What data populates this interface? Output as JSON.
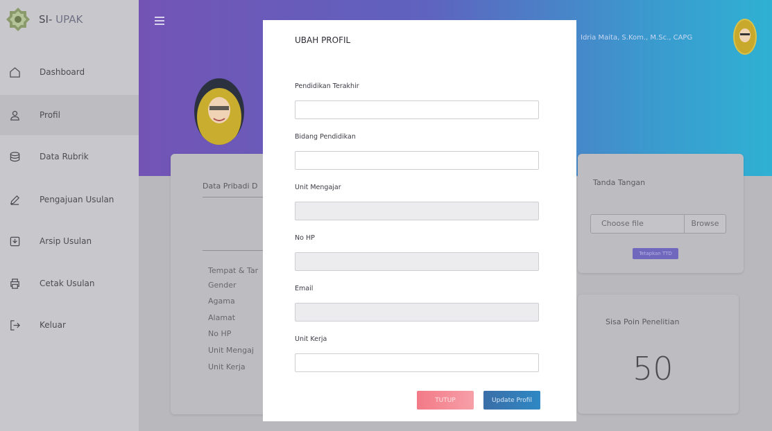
{
  "app": {
    "brand_prefix": "SI-",
    "brand_suffix": "UPAK"
  },
  "sidebar": {
    "items": [
      {
        "label": "Dashboard",
        "icon": "home-icon"
      },
      {
        "label": "Profil",
        "icon": "user-icon",
        "active": true
      },
      {
        "label": "Data Rubrik",
        "icon": "database-icon"
      },
      {
        "label": "Pengajuan Usulan",
        "icon": "pencil-icon"
      },
      {
        "label": "Arsip Usulan",
        "icon": "archive-icon"
      },
      {
        "label": "Cetak Usulan",
        "icon": "printer-icon"
      },
      {
        "label": "Keluar",
        "icon": "logout-icon"
      }
    ]
  },
  "header": {
    "user_name": "Idria Maita, S.Kom., M.Sc., CAPG"
  },
  "data_pribadi": {
    "title": "Data Pribadi D",
    "rows": [
      "Tempat & Tar",
      "Gender",
      "Agama",
      "Alamat",
      "No HP",
      "Unit Mengaj",
      "Unit Kerja"
    ]
  },
  "ttd": {
    "title": "Tanda Tangan",
    "file_label": "Choose file",
    "browse_label": "Browse",
    "button_label": "Tetapkan TTD"
  },
  "poin": {
    "title": "Sisa Poin Penelitian",
    "value": "50"
  },
  "modal": {
    "title": "UBAH PROFIL",
    "fields": [
      {
        "label": "Pendidikan Terakhir",
        "value": "",
        "readonly": false
      },
      {
        "label": "Bidang Pendidikan",
        "value": "",
        "readonly": false
      },
      {
        "label": "Unit Mengajar",
        "value": "",
        "readonly": true
      },
      {
        "label": "No HP",
        "value": "",
        "readonly": true
      },
      {
        "label": "Email",
        "value": "",
        "readonly": true
      },
      {
        "label": "Unit Kerja",
        "value": "",
        "readonly": false
      }
    ],
    "close_label": "TUTUP",
    "submit_label": "Update Profil"
  },
  "colors": {
    "header_start": "#7354b5",
    "header_end": "#2fb1d3",
    "close_button": "#f27a86",
    "submit_button": "#2f88c4"
  }
}
